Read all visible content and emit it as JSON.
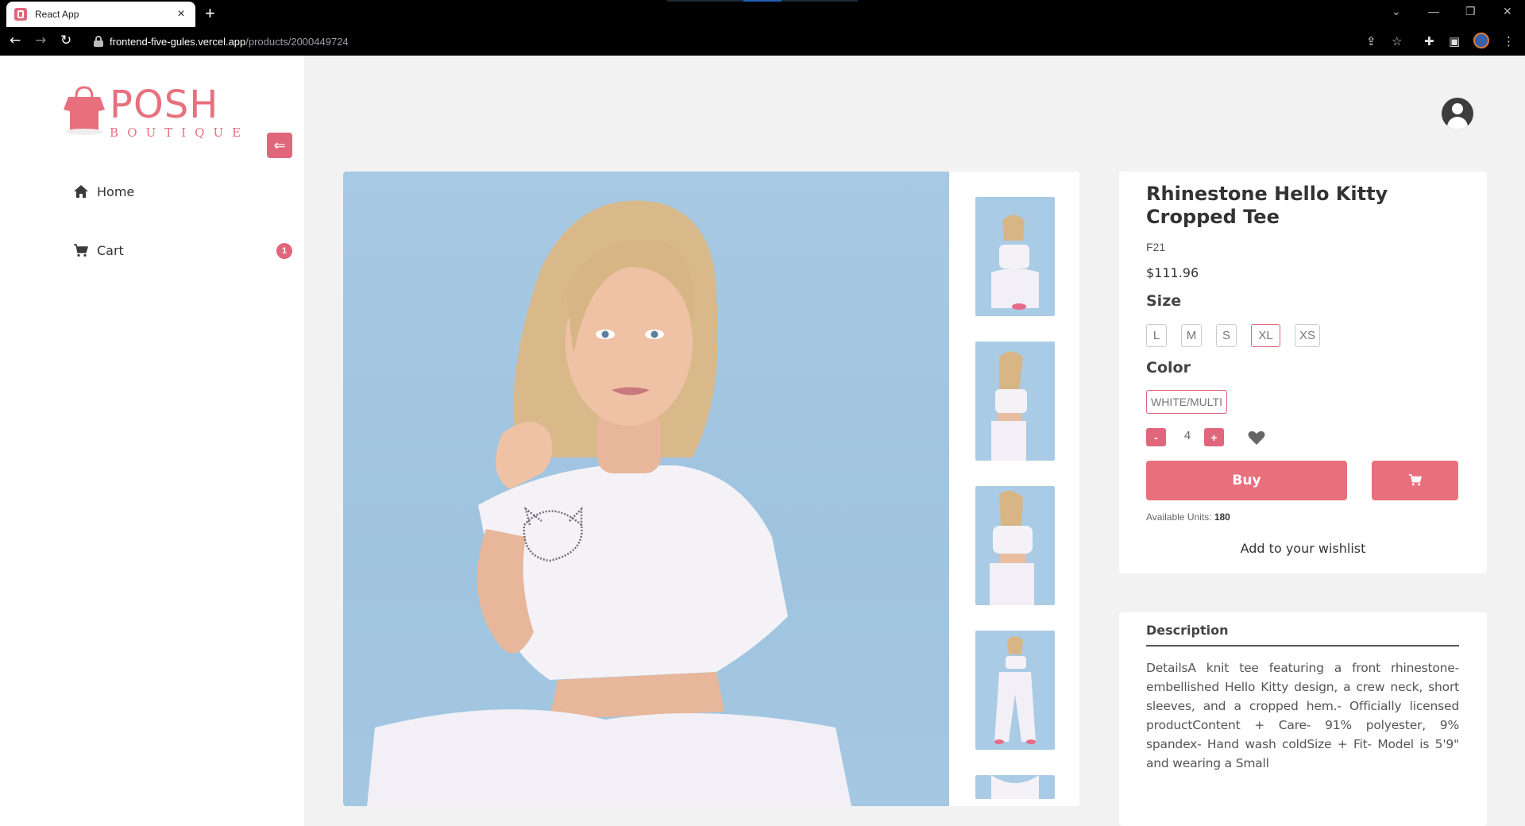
{
  "browser": {
    "tab_title": "React App",
    "tab_close": "×",
    "new_tab": "+",
    "url_host": "frontend-five-gules.vercel.app",
    "url_path": "/products/2000449724"
  },
  "sidebar": {
    "logo_text": "POSH",
    "logo_sub": "BOUTIQUE",
    "collapse_icon": "arrow-left-icon",
    "items": [
      {
        "label": "Home",
        "icon": "home-icon"
      },
      {
        "label": "Cart",
        "icon": "cart-icon",
        "badge": "1"
      }
    ]
  },
  "product": {
    "title": "Rhinestone Hello Kitty Cropped Tee",
    "brand": "F21",
    "price": "$111.96",
    "size_label": "Size",
    "sizes": [
      "L",
      "M",
      "S",
      "XL",
      "XS"
    ],
    "selected_size": "XL",
    "color_label": "Color",
    "color": "WHITE/MULTI",
    "qty_minus": "-",
    "qty_plus": "+",
    "quantity": "4",
    "buy_label": "Buy",
    "available_label": "Available Units: ",
    "available_units": "180",
    "wishlist_label": "Add to your wishlist",
    "thumbnails": 5
  },
  "description": {
    "title": "Description",
    "body": "DetailsA knit tee featuring a front rhinestone-embellished Hello Kitty design, a crew neck, short sleeves, and a cropped hem.- Officially licensed productContent + Care- 91% polyester, 9% spandex- Hand wash coldSize + Fit- Model is 5'9\" and wearing a Small"
  },
  "colors": {
    "accent": "#e0667b",
    "logo": "#e8707d",
    "background": "#f2f2f2",
    "image_bg": "#a7c9e3"
  }
}
